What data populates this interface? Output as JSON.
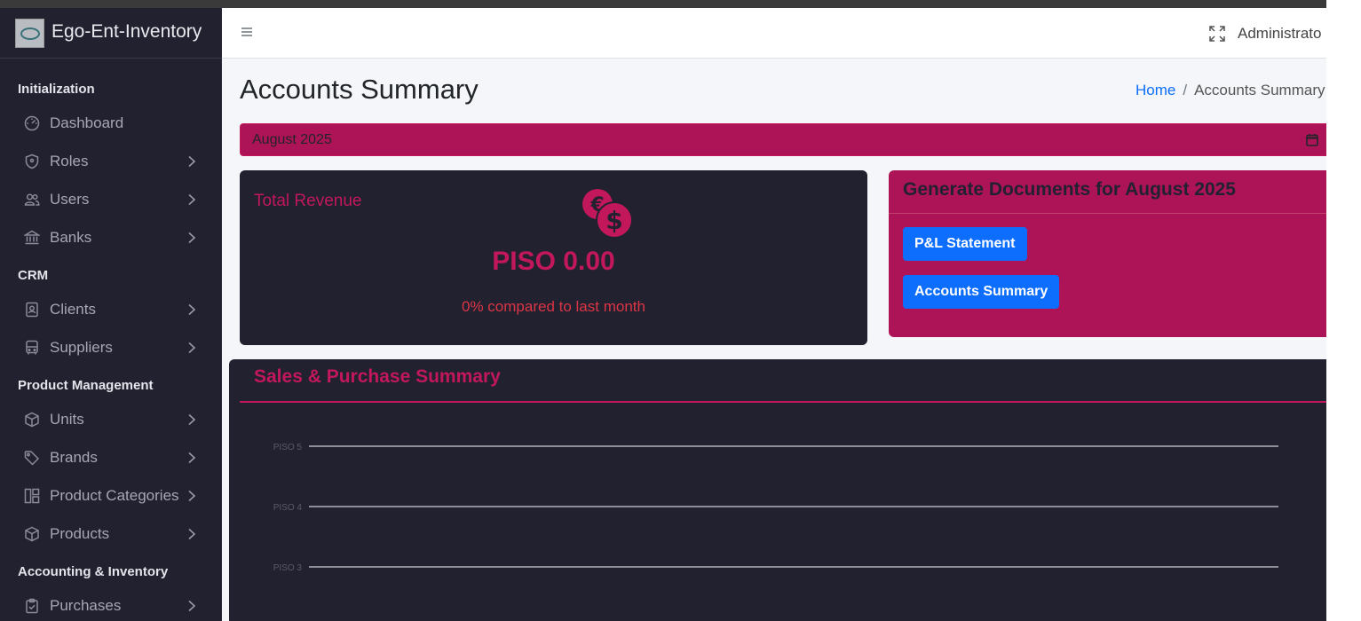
{
  "app": {
    "brand": "Ego-Ent-Inventory"
  },
  "sidebar": {
    "sections": [
      {
        "header": "Initialization"
      },
      {
        "header": "CRM"
      },
      {
        "header": "Product Management"
      },
      {
        "header": "Accounting & Inventory"
      }
    ],
    "items": [
      {
        "label": "Dashboard",
        "icon": "dashboard-icon",
        "has_children": false
      },
      {
        "label": "Roles",
        "icon": "shield-icon",
        "has_children": true
      },
      {
        "label": "Users",
        "icon": "users-icon",
        "has_children": true
      },
      {
        "label": "Banks",
        "icon": "bank-icon",
        "has_children": true
      },
      {
        "label": "Clients",
        "icon": "contact-card-icon",
        "has_children": true
      },
      {
        "label": "Suppliers",
        "icon": "bus-icon",
        "has_children": true
      },
      {
        "label": "Units",
        "icon": "box-icon",
        "has_children": true
      },
      {
        "label": "Brands",
        "icon": "tag-icon",
        "has_children": true
      },
      {
        "label": "Product Categories",
        "icon": "category-icon",
        "has_children": true
      },
      {
        "label": "Products",
        "icon": "box-icon",
        "has_children": true
      },
      {
        "label": "Purchases",
        "icon": "clipboard-check-icon",
        "has_children": true
      }
    ]
  },
  "topbar": {
    "user": "Administrato"
  },
  "page": {
    "title": "Accounts Summary",
    "breadcrumb": {
      "home": "Home",
      "separator": "/",
      "current": "Accounts Summary"
    }
  },
  "month_filter": {
    "value": "August 2025"
  },
  "revenue_card": {
    "title": "Total Revenue",
    "amount": "PISO 0.00",
    "comparison": "0% compared to last month"
  },
  "generate_card": {
    "title": "Generate Documents for August 2025",
    "pl_button": "P&L Statement",
    "accounts_button": "Accounts Summary"
  },
  "sales_card": {
    "title": "Sales & Purchase Summary"
  },
  "chart_data": {
    "type": "line",
    "title": "",
    "series": [],
    "y_ticks": [
      "PISO 5",
      "PISO 4",
      "PISO 3"
    ],
    "ylim": [
      3,
      5
    ],
    "grid": true
  },
  "colors": {
    "accent": "#c2185b",
    "card_dark": "#212130",
    "button_primary": "#0d6efd",
    "sidebar_bg": "#212130"
  }
}
